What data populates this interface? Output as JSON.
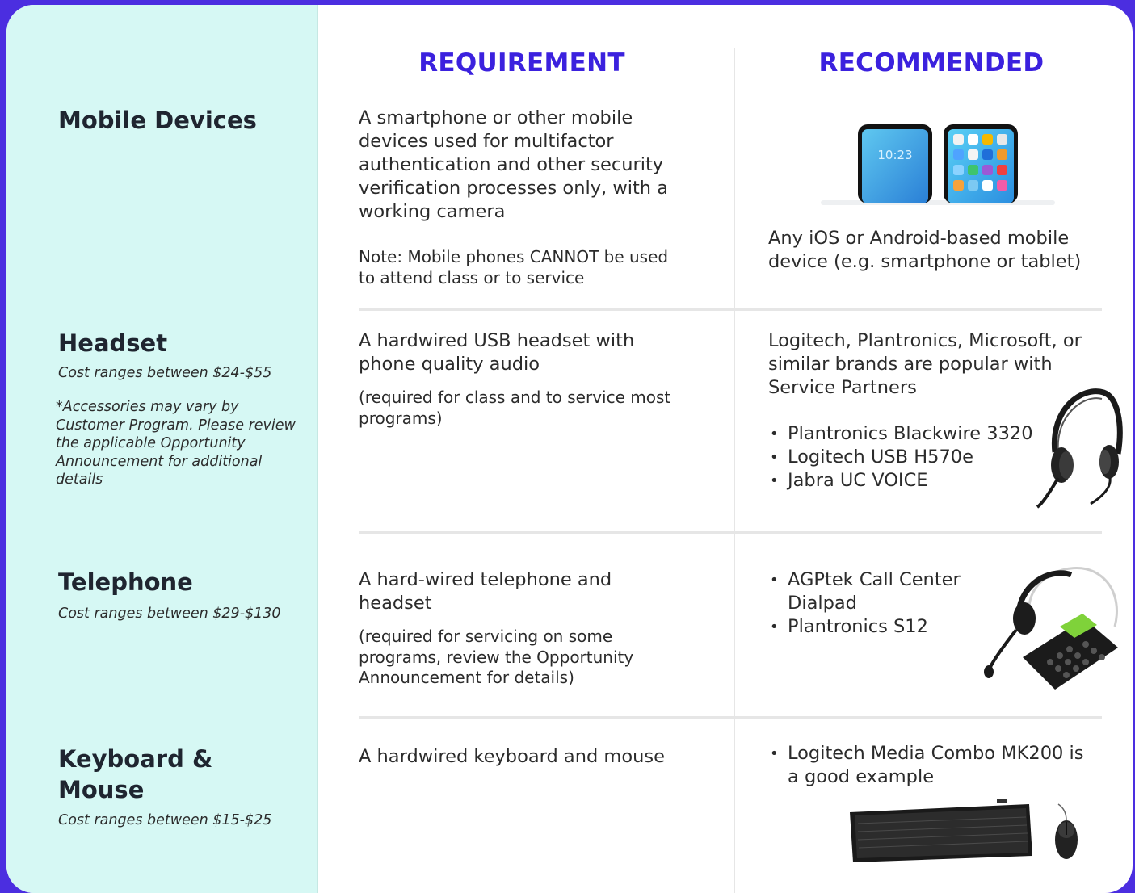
{
  "headers": {
    "requirement": "REQUIREMENT",
    "recommended": "RECOMMENDED"
  },
  "rows": [
    {
      "category": "Mobile Devices",
      "requirement": "A smartphone or other mobile devices used for multifactor authentication and other security verification processes only, with a working camera",
      "requirement_note": "Note: Mobile phones CANNOT be used to attend class or to service",
      "recommended": "Any iOS or Android-based mobile device (e.g. smartphone or tablet)",
      "phone_clock": "10:23"
    },
    {
      "category": "Headset",
      "cost": "Cost ranges between $24-$55",
      "note": "*Accessories may vary by Customer Program. Please review the applicable Opportunity Announcement for additional details",
      "requirement": "A hardwired USB headset with phone quality audio",
      "requirement_note": "(required for class and to service most programs)",
      "recommended": "Logitech, Plantronics, Microsoft, or similar brands are popular with Service Partners",
      "items": [
        "Plantronics Blackwire 3320",
        "Logitech USB H570e",
        "Jabra UC VOICE"
      ]
    },
    {
      "category": "Telephone",
      "cost": "Cost ranges between $29-$130",
      "requirement": "A hard-wired telephone and headset",
      "requirement_note": "(required for servicing on some programs, review the Opportunity Announcement for details)",
      "items": [
        "AGPtek Call Center Dialpad",
        "Plantronics S12"
      ]
    },
    {
      "category": "Keyboard & Mouse",
      "cost": "Cost ranges between $15-$25",
      "requirement": "A hardwired keyboard and mouse",
      "items": [
        "Logitech Media Combo MK200 is a good example"
      ]
    }
  ]
}
